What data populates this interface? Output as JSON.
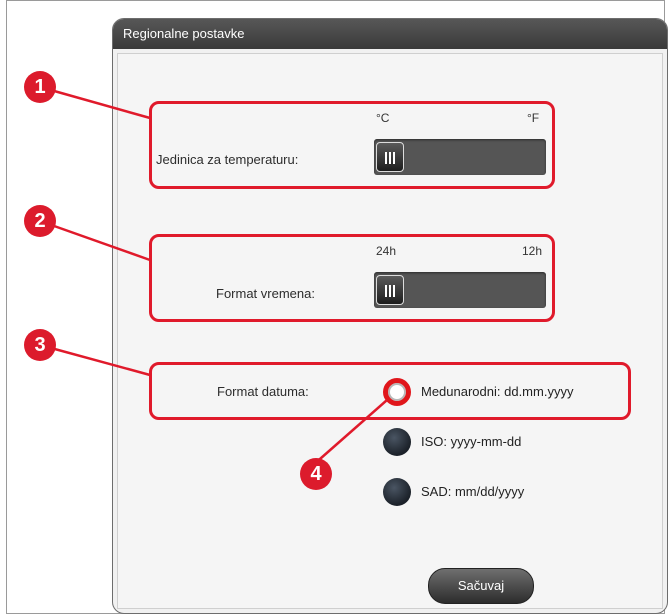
{
  "dialog": {
    "title": "Regionalne postavke"
  },
  "temperature": {
    "label": "Jedinica za temperaturu:",
    "option_left": "°C",
    "option_right": "°F",
    "selected": "°C"
  },
  "time_format": {
    "label": "Format vremena:",
    "option_left": "24h",
    "option_right": "12h",
    "selected": "24h"
  },
  "date_format": {
    "label": "Format datuma:",
    "options": [
      {
        "label": "Medunarodni: dd.mm.yyyy",
        "selected": true
      },
      {
        "label": "ISO: yyyy-mm-dd",
        "selected": false
      },
      {
        "label": "SAD: mm/dd/yyyy",
        "selected": false
      }
    ]
  },
  "save_label": "Sačuvaj",
  "callouts": [
    "1",
    "2",
    "3",
    "4"
  ],
  "colors": {
    "highlight": "#e01a2b",
    "title_bar": "#4a4a4a",
    "slider": "#555555"
  }
}
